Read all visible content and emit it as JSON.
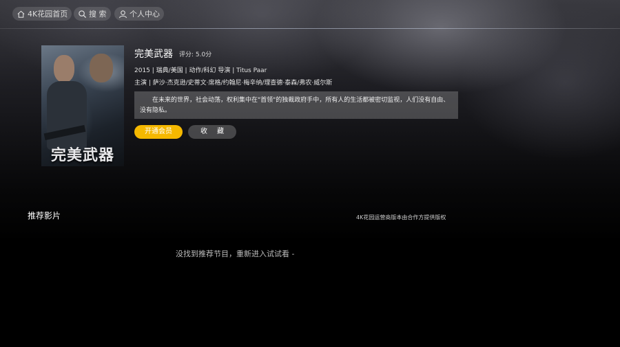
{
  "nav": {
    "home_label": "4K花园首页",
    "search_label": "搜 索",
    "user_label": "个人中心",
    "icons": [
      "home-icon",
      "search-icon",
      "user-icon"
    ]
  },
  "movie": {
    "poster_title": "完美武器",
    "title": "完美武器",
    "rating": "评分: 5.0分",
    "meta": "2015 | 瑞典/美国 | 动作/科幻   导演 | Titus Paar",
    "cast": "主演 | 萨沙·杰克逊/史蒂文·席格/约翰尼·梅辛纳/理查德·泰森/弗农·威尔斯",
    "synopsis": "在未来的世界，社会动荡，权利集中在\"首领\"的独裁政府手中，所有人的生活都被密切监视，人们没有自由、没有隐私。"
  },
  "buttons": {
    "vip_label": "开通会员",
    "favorite_label": "收藏"
  },
  "recommend": {
    "title": "推荐影片",
    "copyright": "4K花园运营商版本由合作方提供版权",
    "empty_message": "没找到推荐节目，重新进入试试看 -"
  },
  "colors": {
    "accent": "#f5b800",
    "background": "#000000"
  }
}
